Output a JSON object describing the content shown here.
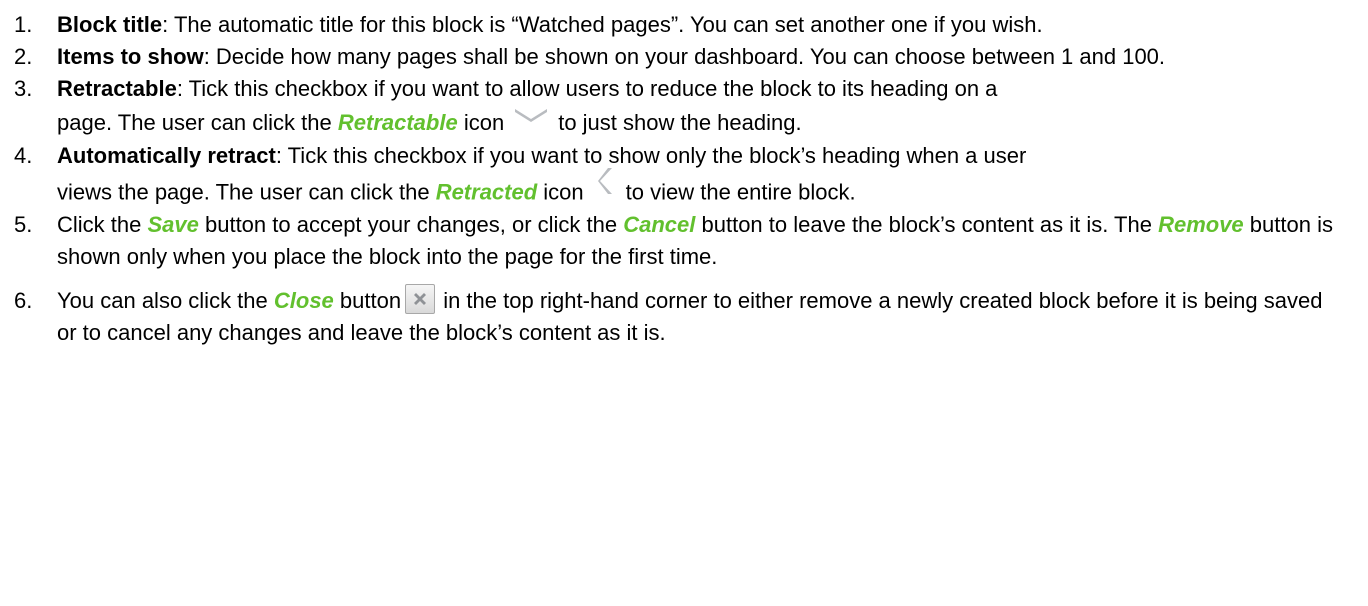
{
  "items": [
    {
      "num": "1.",
      "term": "Block title",
      "text": ": The automatic title for this block is “Watched pages”. You can set another one if you wish."
    },
    {
      "num": "2.",
      "term": "Items to show",
      "text": ": Decide how many pages shall be shown on your dashboard. You can choose between 1 and 100."
    },
    {
      "num": "3.",
      "term": "Retractable",
      "text_a": ": Tick this checkbox if you want to allow users to reduce the block to its heading on a",
      "text_b": "page. The user can click the ",
      "hl": "Retractable",
      "text_c": " icon",
      "text_d": "to just show the heading."
    },
    {
      "num": "4.",
      "term": "Automatically retract",
      "text_a": ": Tick this checkbox if you want to show only the block’s heading when a user",
      "text_b": "views the page. The user can click the ",
      "hl": "Retracted",
      "text_c": " icon",
      "text_d": "to view the entire block."
    },
    {
      "num": "5.",
      "p1": "Click the ",
      "hl1": "Save",
      "p2": " button to accept your changes, or click the ",
      "hl2": "Cancel",
      "p3": " button to leave the block’s content as it is. The ",
      "hl3": "Remove",
      "p4": " button is shown only when you place the block into the page for the first time."
    },
    {
      "num": "6.",
      "p1": "You can also click the ",
      "hl1": "Close",
      "p2": " button",
      "p3": " in the top right-hand corner to either remove a newly created block before it is being saved or to cancel any changes and leave the block’s content as it is."
    }
  ],
  "colors": {
    "highlight": "#62c02e",
    "icon": "#b9bcc0"
  },
  "icons": [
    "chevron-down-icon",
    "chevron-left-icon",
    "close-x-icon"
  ]
}
